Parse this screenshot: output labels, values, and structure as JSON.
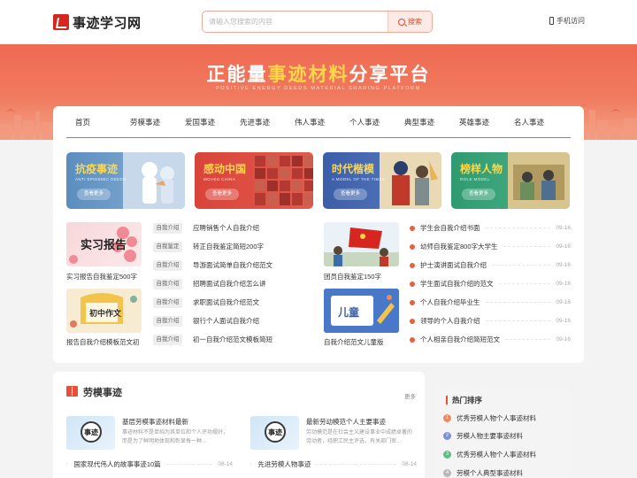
{
  "header": {
    "logo_text": "事迹学习网",
    "search_placeholder": "请输入您搜索的内容",
    "search_button": "搜索",
    "mobile_link": "手机访问"
  },
  "banner": {
    "title_a": "正能量",
    "title_hl": "事迹材料",
    "title_b": "分享平台",
    "subtitle": "POSITIVE ENERGY DEEDS MATERIAL SHARING PLATFORM"
  },
  "nav": [
    "首页",
    "劳模事迹",
    "爱国事迹",
    "先进事迹",
    "伟人事迹",
    "个人事迹",
    "典型事迹",
    "英雄事迹",
    "名人事迹"
  ],
  "tiles": [
    {
      "title": "抗疫事迹",
      "sub": "ANTI EPIDEMIC DEEDS",
      "button": "查看更多",
      "color": "#5a8dbf"
    },
    {
      "title": "感动中国",
      "sub": "MOVED CHINA",
      "button": "查看更多",
      "color": "#d9443a"
    },
    {
      "title": "时代楷模",
      "sub": "A MODEL OF THE TIMES",
      "button": "查看更多",
      "color": "#3b5ea8"
    },
    {
      "title": "榜样人物",
      "sub": "ROLE MODEL",
      "button": "查看更多",
      "color": "#2f9a70"
    }
  ],
  "left_thumbs": [
    {
      "caption": "实习报告自我鉴定500字",
      "label": "实习报告"
    },
    {
      "caption": "报告自我介绍模板范文初",
      "label": "初中作文"
    }
  ],
  "left_articles": [
    {
      "tag": "自我介绍",
      "title": "应聘销售个人自我介绍"
    },
    {
      "tag": "自我鉴定",
      "title": "转正自我鉴定简短200字"
    },
    {
      "tag": "自我介绍",
      "title": "导游面试简单自我介绍范文"
    },
    {
      "tag": "自我介绍",
      "title": "招聘面试自我介绍怎么讲"
    },
    {
      "tag": "自我介绍",
      "title": "求职面试自我介绍范文"
    },
    {
      "tag": "自我介绍",
      "title": "银行个人面试自我介绍"
    },
    {
      "tag": "自我介绍",
      "title": "初一自我介绍范文模板简短"
    }
  ],
  "right_thumbs": [
    {
      "caption": "团员自我鉴定150字",
      "label": ""
    },
    {
      "caption": "自我介绍范文儿童版",
      "label": "儿童"
    }
  ],
  "right_articles": [
    {
      "title": "学生会自我介绍书面",
      "date": "09-16"
    },
    {
      "title": "幼师自我鉴定800字大学生",
      "date": "09-16"
    },
    {
      "title": "护士演讲面试自我介绍",
      "date": "09-16"
    },
    {
      "title": "学生面试自我介绍的范文",
      "date": "09-16"
    },
    {
      "title": "个人自我介绍毕业生",
      "date": "09-16"
    },
    {
      "title": "领导的个人自我介绍",
      "date": "09-16"
    },
    {
      "title": "个人相亲自我介绍简短范文",
      "date": "09-16"
    }
  ],
  "section": {
    "title": "劳模事迹",
    "more": "更多",
    "features": [
      {
        "thumb": "事迹",
        "title": "基层劳模事迹材料最新",
        "desc": "事迹材料不是单纯为其单位和个人评功摆好，而是为了鲜明地体现和彰显每一种..."
      },
      {
        "thumb": "事迹",
        "title": "最新劳动模范个人主要事迹",
        "desc": "劳动模范是在社会主义建设事业中成绩卓著的劳动者，经职工民主评选，有关部门审..."
      }
    ],
    "list": [
      {
        "title": "国家现代伟人的故事事迹10篇",
        "date": "08-14"
      },
      {
        "title": "先进劳模人物事迹",
        "date": "08-14"
      }
    ]
  },
  "ranking": {
    "title": "热门排序",
    "items": [
      {
        "num": "1",
        "title": "优秀劳模人物个人事迹材料",
        "color": "#f08a5d"
      },
      {
        "num": "2",
        "title": "劳模人物主要事迹材料",
        "color": "#7b8fd9"
      },
      {
        "num": "3",
        "title": "优秀劳模人物个人事迹材料",
        "color": "#5bbf7f"
      },
      {
        "num": "4",
        "title": "劳模个人典型事迹材料",
        "color": "#b8b8b8"
      }
    ]
  }
}
